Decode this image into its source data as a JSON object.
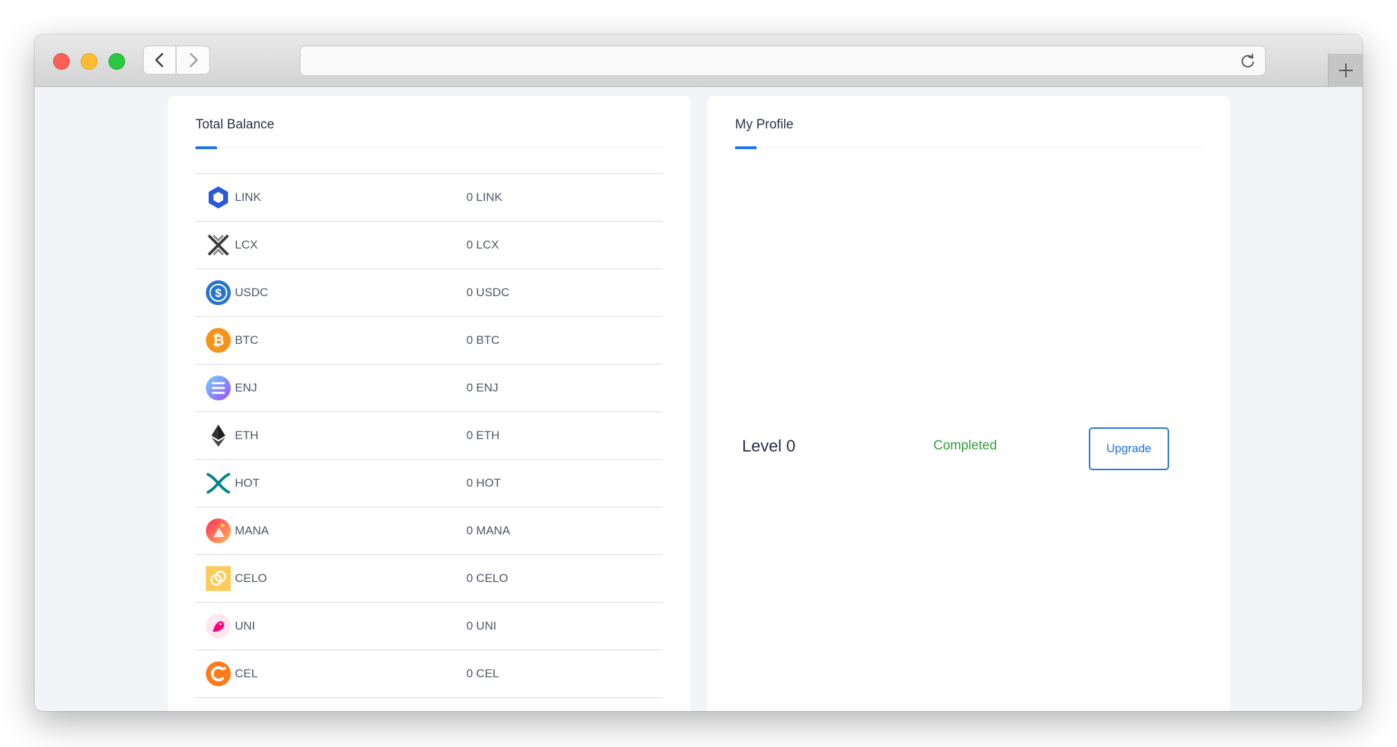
{
  "browser": {
    "url": "",
    "icons": {
      "back": "chevron-left-icon",
      "forward": "chevron-right-icon",
      "reload": "reload-icon",
      "new_tab": "plus-icon"
    }
  },
  "balance_panel": {
    "title": "Total Balance",
    "coins": [
      {
        "name": "LINK",
        "balance": "0 LINK",
        "icon": "chainlink-icon"
      },
      {
        "name": "LCX",
        "balance": "0 LCX",
        "icon": "lcx-icon"
      },
      {
        "name": "USDC",
        "balance": "0 USDC",
        "icon": "usdc-icon"
      },
      {
        "name": "BTC",
        "balance": "0 BTC",
        "icon": "bitcoin-icon"
      },
      {
        "name": "ENJ",
        "balance": "0 ENJ",
        "icon": "enjin-icon"
      },
      {
        "name": "ETH",
        "balance": "0 ETH",
        "icon": "ethereum-icon"
      },
      {
        "name": "HOT",
        "balance": "0 HOT",
        "icon": "holo-icon"
      },
      {
        "name": "MANA",
        "balance": "0 MANA",
        "icon": "decentraland-icon"
      },
      {
        "name": "CELO",
        "balance": "0 CELO",
        "icon": "celo-icon"
      },
      {
        "name": "UNI",
        "balance": "0 UNI",
        "icon": "uniswap-icon"
      },
      {
        "name": "CEL",
        "balance": "0 CEL",
        "icon": "celsius-icon"
      }
    ]
  },
  "profile_panel": {
    "title": "My Profile",
    "level": "Level 0",
    "status": "Completed",
    "upgrade_label": "Upgrade"
  },
  "colors": {
    "accent": "#1a73e8",
    "status_green": "#2e9e3a",
    "page_bg": "#f3f4f8",
    "text": "#2a2f45"
  }
}
